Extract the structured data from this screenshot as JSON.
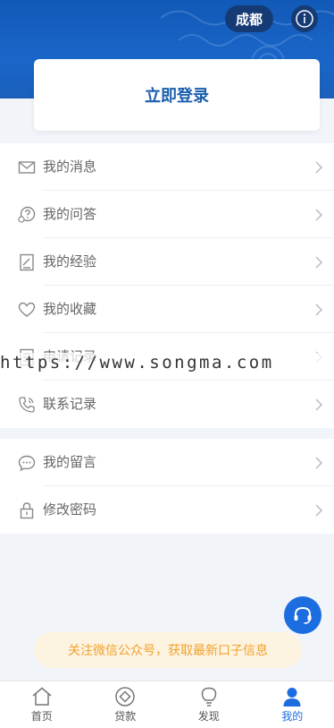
{
  "header": {
    "city": "成都",
    "info_icon": "info-icon"
  },
  "login": {
    "label": "立即登录"
  },
  "menu_group_1": [
    {
      "label": "我的消息",
      "icon": "mail-icon"
    },
    {
      "label": "我的问答",
      "icon": "qa-icon"
    },
    {
      "label": "我的经验",
      "icon": "note-icon"
    },
    {
      "label": "我的收藏",
      "icon": "heart-icon"
    },
    {
      "label": "申请记录",
      "icon": "record-icon"
    },
    {
      "label": "联系记录",
      "icon": "phone-icon"
    }
  ],
  "menu_group_2": [
    {
      "label": "我的留言",
      "icon": "chat-icon"
    },
    {
      "label": "修改密码",
      "icon": "lock-icon"
    }
  ],
  "watermark": "https://www.songma.com",
  "banner": {
    "text": "关注微信公众号，获取最新口子信息"
  },
  "tabs": [
    {
      "label": "首页",
      "icon": "home-icon"
    },
    {
      "label": "贷款",
      "icon": "loan-icon"
    },
    {
      "label": "发现",
      "icon": "bulb-icon"
    },
    {
      "label": "我的",
      "icon": "user-icon"
    }
  ],
  "colors": {
    "primary": "#1c6de0",
    "hero": "#1a66c8",
    "banner_text": "#f0a22a"
  }
}
